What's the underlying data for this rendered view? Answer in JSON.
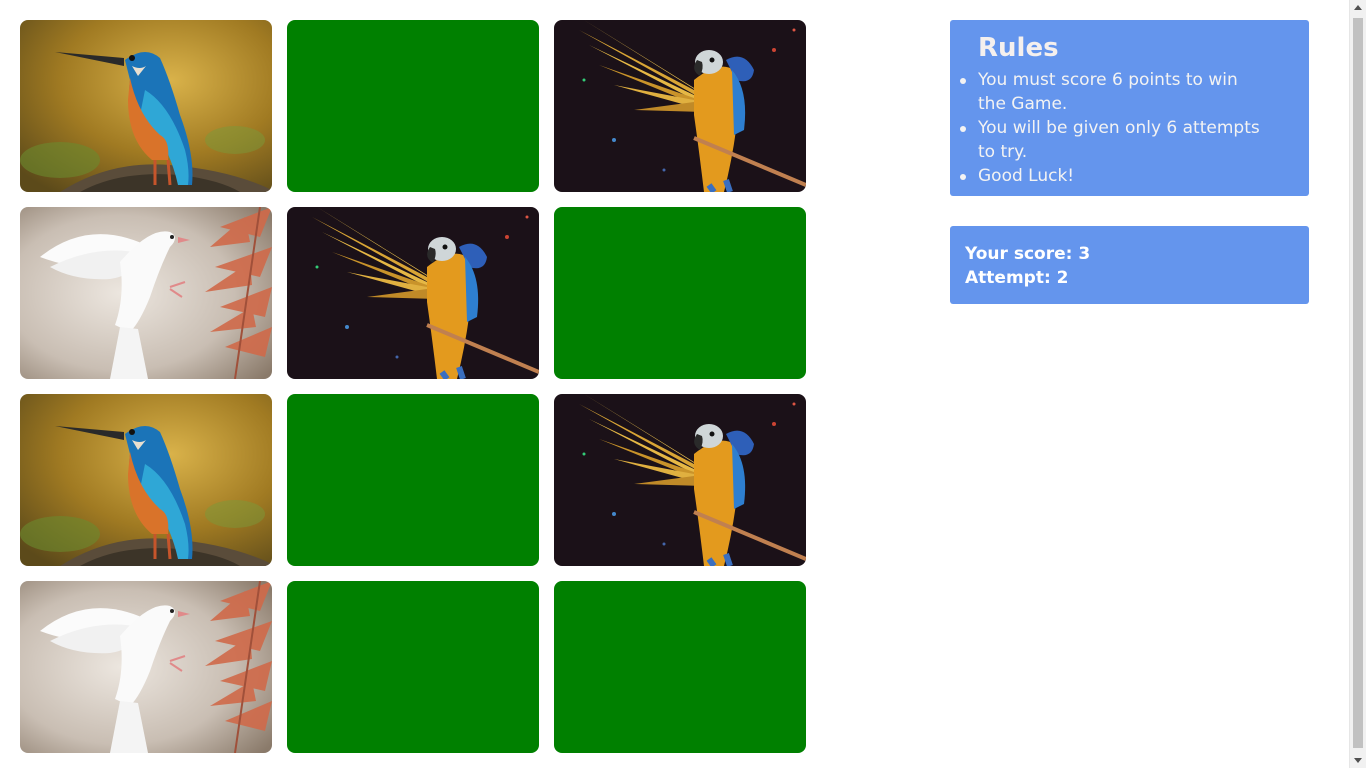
{
  "board": {
    "cards": [
      {
        "state": "revealed",
        "image": "kingfisher"
      },
      {
        "state": "hidden",
        "image": "card-back"
      },
      {
        "state": "revealed",
        "image": "macaw"
      },
      {
        "state": "revealed",
        "image": "dove"
      },
      {
        "state": "revealed",
        "image": "macaw"
      },
      {
        "state": "hidden",
        "image": "card-back"
      },
      {
        "state": "revealed",
        "image": "kingfisher"
      },
      {
        "state": "hidden",
        "image": "card-back"
      },
      {
        "state": "revealed",
        "image": "macaw"
      },
      {
        "state": "revealed",
        "image": "dove"
      },
      {
        "state": "hidden",
        "image": "card-back"
      },
      {
        "state": "hidden",
        "image": "card-back"
      }
    ],
    "colors": {
      "card_back": "#008000"
    }
  },
  "rules": {
    "title": "Rules",
    "items": [
      "You must score 6 points to win the Game.",
      "You will be given only 6 attempts to try.",
      "Good Luck!"
    ]
  },
  "scoreboard": {
    "score_text": "Your score: 3",
    "attempt_text": "Attempt: 2"
  },
  "colors": {
    "panel": "#6495ed",
    "text": "#ffffff"
  }
}
